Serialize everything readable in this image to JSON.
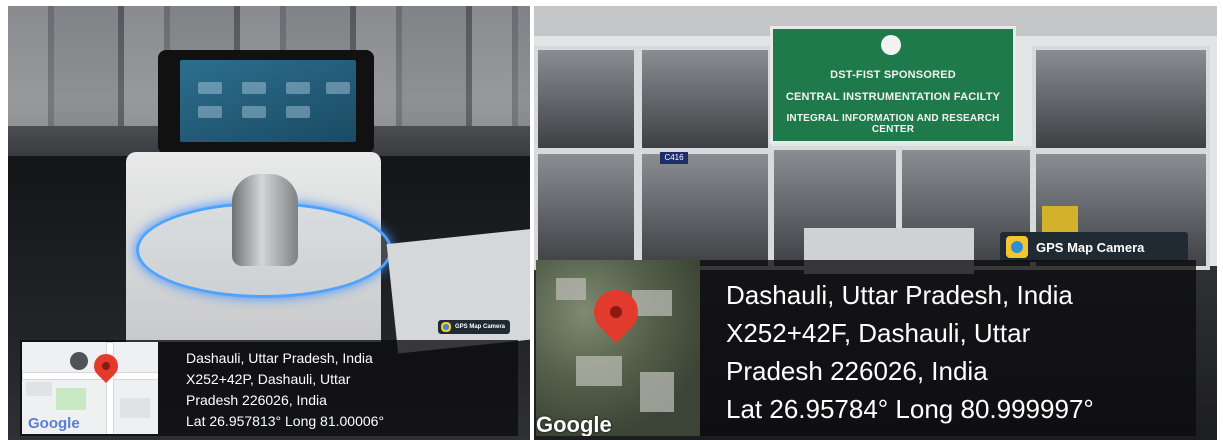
{
  "left_photo": {
    "gps_badge_label": "GPS Map Camera",
    "address_line1": "Dashauli, Uttar Pradesh, India",
    "address_line2": "X252+42P, Dashauli, Uttar",
    "address_line3": "Pradesh 226026, India",
    "coordinates": "Lat 26.957813° Long 81.00006°",
    "map_attribution": "Google"
  },
  "right_photo": {
    "sign": {
      "line1": "DST-FIST SPONSORED",
      "line2": "CENTRAL INSTRUMENTATION FACILTY",
      "line3": "INTEGRAL INFORMATION AND RESEARCH CENTER"
    },
    "door_tag": "C416",
    "gps_badge_label": "GPS Map Camera",
    "address_line1": "Dashauli, Uttar Pradesh, India",
    "address_line2": "X252+42F, Dashauli, Uttar",
    "address_line3": "Pradesh 226026, India",
    "coordinates": "Lat 26.95784° Long 80.999997°",
    "map_attribution": "Google"
  },
  "colors": {
    "pin": "#e23b2e",
    "badge_bg": "#1f2a33",
    "sign_green": "#1f7a4b",
    "ring_glow": "#4da3ff"
  }
}
